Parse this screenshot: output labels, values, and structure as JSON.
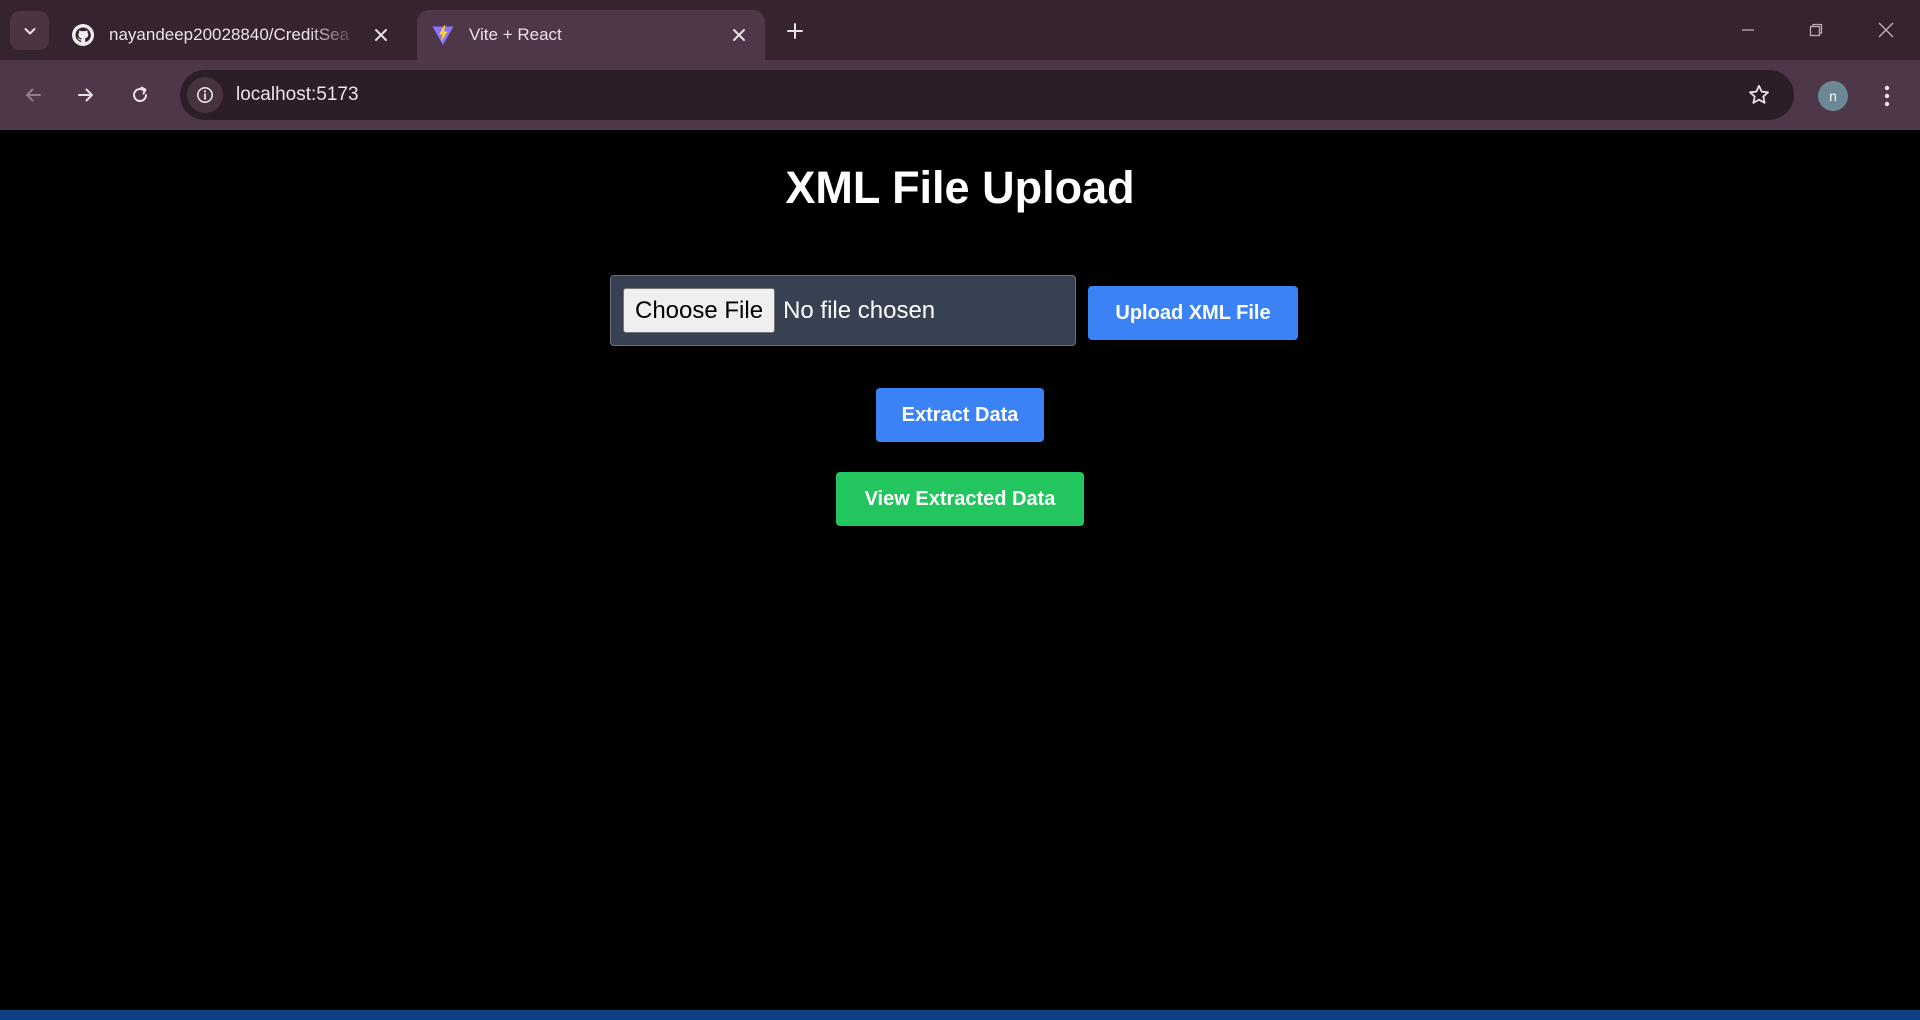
{
  "browser": {
    "tabs": [
      {
        "title": "nayandeep20028840/CreditSea",
        "favicon": "github-icon",
        "active": false
      },
      {
        "title": "Vite + React",
        "favicon": "vite-icon",
        "active": true
      }
    ],
    "address_bar": {
      "url": "localhost:5173"
    },
    "profile_initial": "n"
  },
  "page": {
    "title": "XML File Upload",
    "file_input": {
      "button_label": "Choose File",
      "status": "No file chosen"
    },
    "buttons": {
      "upload": "Upload XML File",
      "extract": "Extract Data",
      "view": "View Extracted Data"
    }
  },
  "colors": {
    "primary_button": "#3b82f6",
    "success_button": "#22c55e",
    "page_background": "#000000",
    "tab_strip": "#35242f",
    "toolbar": "#4e3748"
  }
}
